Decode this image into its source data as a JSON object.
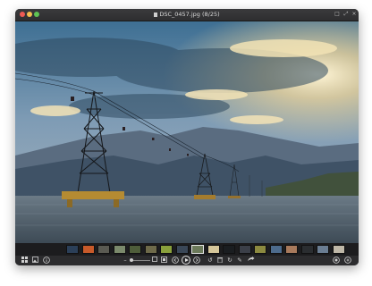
{
  "window": {
    "title": "DSC_0457.jpg (8/25)"
  },
  "toolbar": {
    "view_icons": [
      "grid-icon",
      "image-icon",
      "info-icon"
    ],
    "nav_icons": [
      "photo-small-icon",
      "photo-large-icon",
      "prev-icon",
      "next-icon"
    ],
    "edit_icons": [
      "rotate-left-icon",
      "trash-icon",
      "rotate-right-icon",
      "edit-icon",
      "share-icon"
    ],
    "right_icons": [
      "adjust-icon",
      "fullscreen-icon"
    ]
  },
  "filmstrip": {
    "selected_index": 8,
    "thumb_colors": [
      "#2b3f58",
      "#c85a2a",
      "#5a5a52",
      "#7b8a6c",
      "#4e5d3a",
      "#6e6a4a",
      "#8aa13c",
      "#3a4757",
      "#6c7a5a",
      "#d6c79a",
      "#1a1d20",
      "#3b3f48",
      "#8c8a40",
      "#4d6b8c",
      "#a87a5c",
      "#2a2d30",
      "#6a7d92",
      "#bfb8a8"
    ]
  },
  "colors": {
    "accent": "#e6e6e6",
    "window_bg": "#2a2a2c"
  }
}
